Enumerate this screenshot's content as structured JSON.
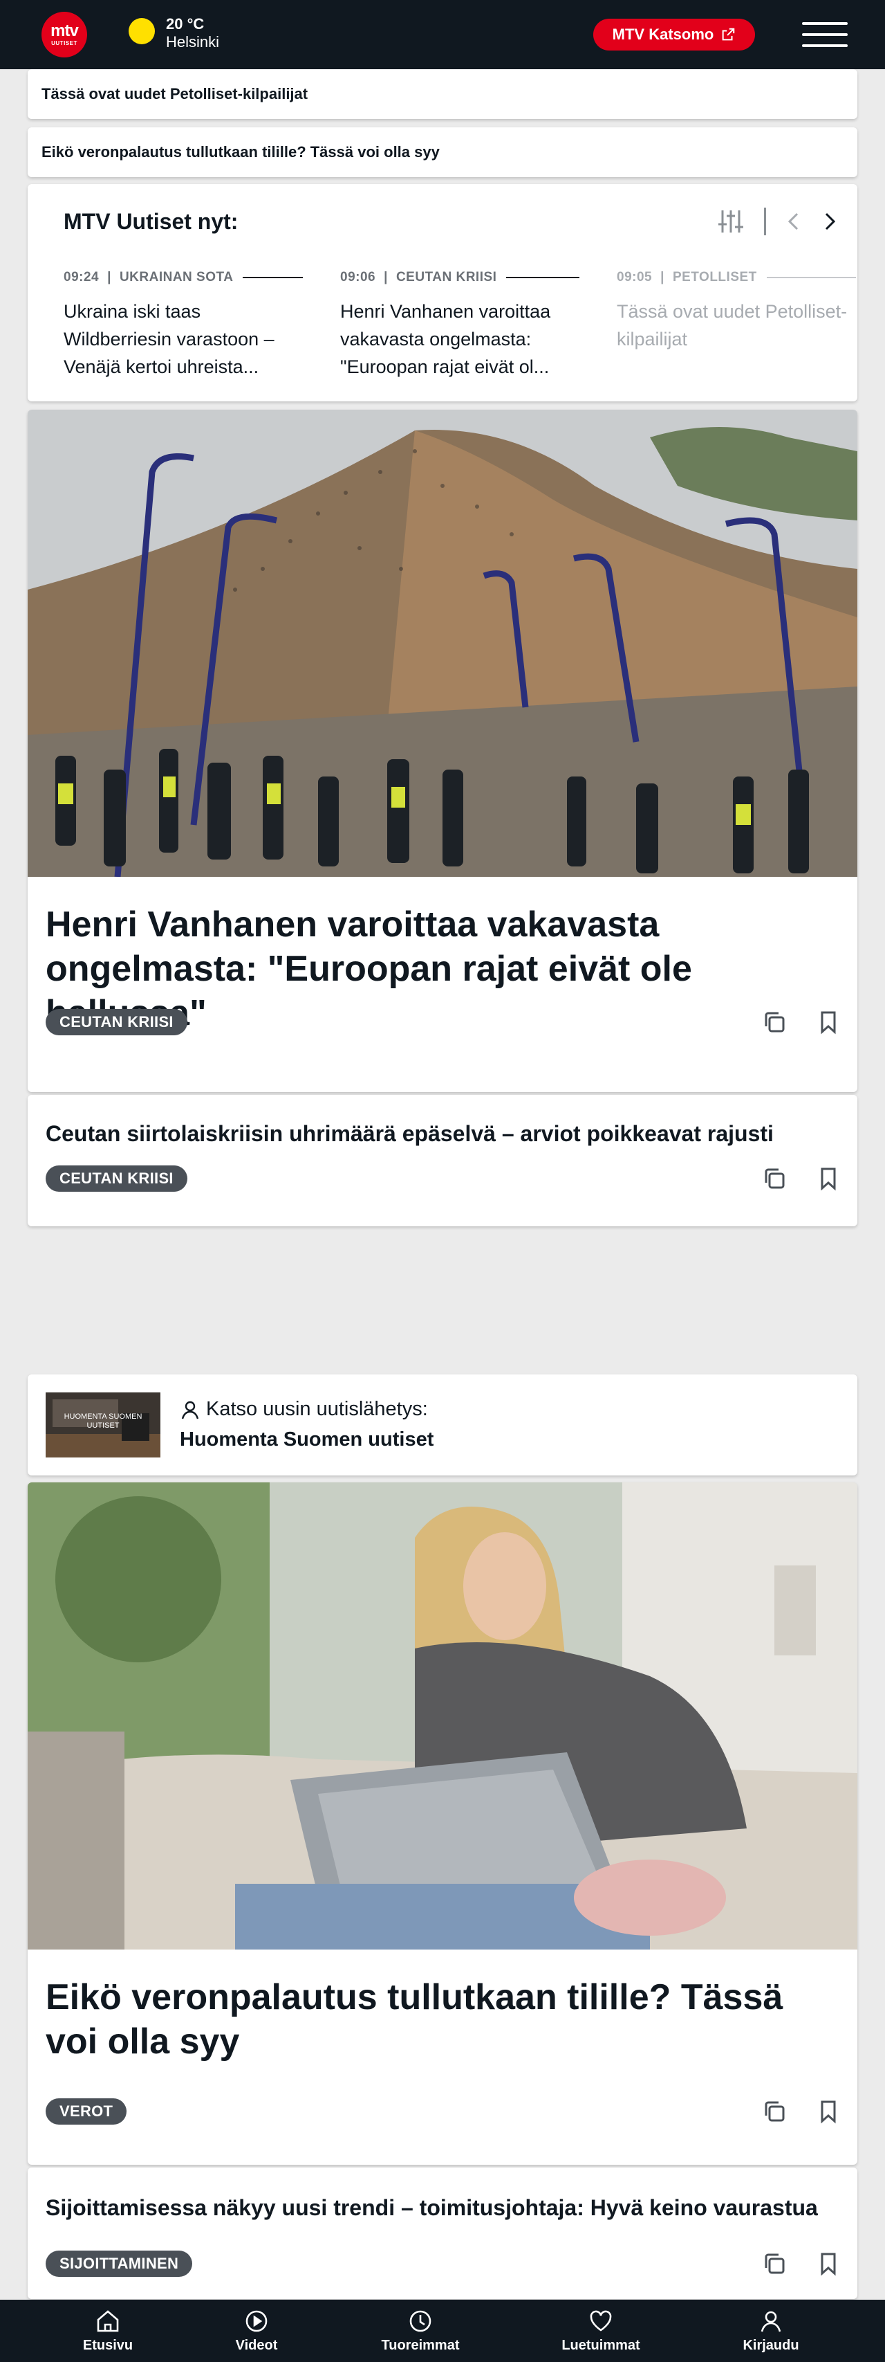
{
  "header": {
    "logo_top": "mtv",
    "logo_bottom": "UUTISET",
    "temperature": "20 °C",
    "city": "Helsinki",
    "katsomo_label": "MTV Katsomo"
  },
  "quick_links": [
    "Tässä ovat uudet Petolliset-kilpailijat",
    "Eikö veronpalautus tullutkaan tilille? Tässä voi olla syy"
  ],
  "ticker": {
    "title": "MTV Uutiset nyt:",
    "items": [
      {
        "time": "09:24",
        "category": "UKRAINAN SOTA",
        "text": "Ukraina iski taas Wildberriesin varastoon – Venäjä kertoi uhreista..."
      },
      {
        "time": "09:06",
        "category": "CEUTAN KRIISI",
        "text": "Henri Vanhanen varoittaa vakavasta ongelmasta: \"Euroopan rajat eivät ol..."
      },
      {
        "time": "09:05",
        "category": "PETOLLISET",
        "text": "Tässä ovat uudet Petolliset-kilpailijat"
      }
    ]
  },
  "article1": {
    "headline": "Henri Vanhanen varoittaa vakavasta ongelmasta: \"Euroopan rajat eivät ole hallussa\"",
    "tag": "CEUTAN KRIISI"
  },
  "article2": {
    "headline": "Ceutan siirtolaiskriisin uhrimäärä epäselvä – arviot poikkeavat rajusti",
    "tag": "CEUTAN KRIISI"
  },
  "live_promo": {
    "label": "Katso uusin uutislähetys:",
    "title": "Huomenta Suomen uutiset",
    "thumb_caption": "HUOMENTA SUOMEN UUTISET"
  },
  "article3": {
    "headline": "Eikö veronpalautus tullutkaan tilille? Tässä voi olla syy",
    "tag": "VEROT"
  },
  "article4": {
    "headline": "Sijoittamisessa näkyy uusi trendi – toimitusjohtaja: Hyvä keino vaurastua",
    "tag": "SIJOITTAMINEN"
  },
  "bottom_nav": [
    "Etusivu",
    "Videot",
    "Tuoreimmat",
    "Luetuimmat",
    "Kirjaudu"
  ],
  "colors": {
    "brand": "#e2001a",
    "dark": "#101820",
    "tag": "#4a5057"
  }
}
